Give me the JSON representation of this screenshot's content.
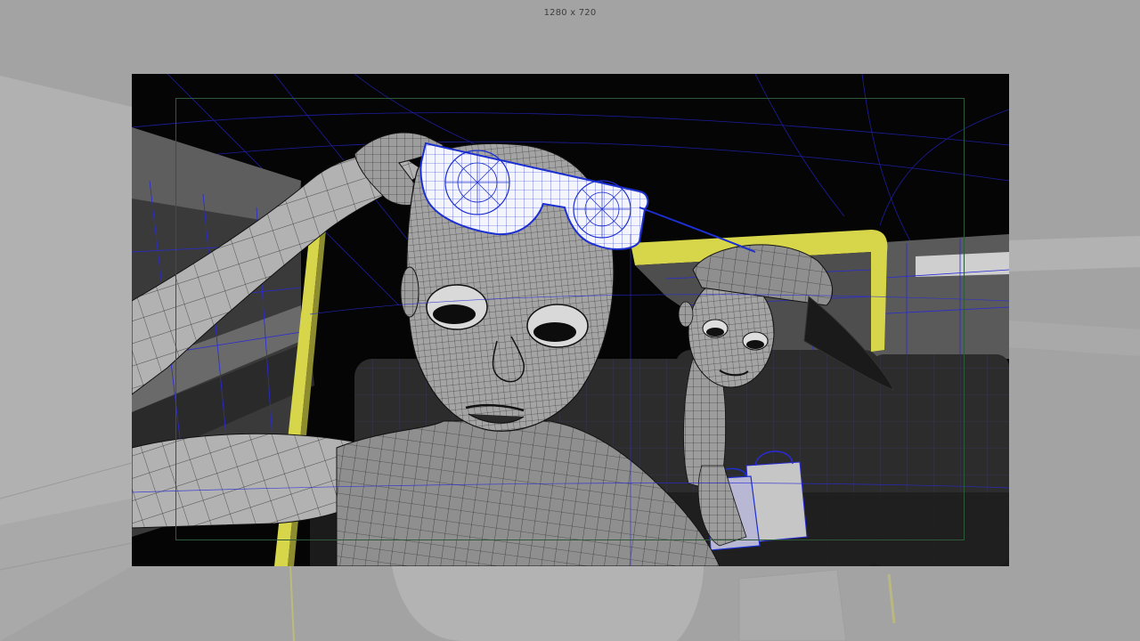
{
  "viewport": {
    "resolution_label": "1280 x 720"
  },
  "colors": {
    "background": "#a3a3a3",
    "frame_background": "#050505",
    "wireframe_black": "#111111",
    "wireframe_blue": "#2a2ad8",
    "selected_blue": "#1c2fd0",
    "safe_frame": "#2f5a3a",
    "car_yellow": "#d7d64a",
    "mesh_gray": "#9a9a9a"
  },
  "icons": {
    "scene": "wireframe-scene-icon"
  }
}
